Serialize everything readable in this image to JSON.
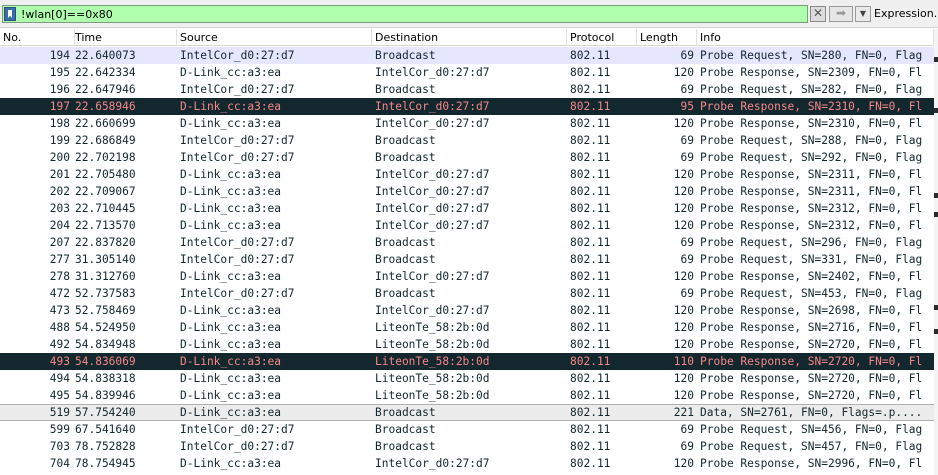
{
  "filter": {
    "value": "!wlan[0]==0x80",
    "clear_glyph": "✕",
    "apply_glyph": "➡",
    "dropdown_glyph": "▼",
    "expression_label": "Expression..."
  },
  "columns": [
    "No.",
    "Time",
    "Source",
    "Destination",
    "Protocol",
    "Length",
    "Info"
  ],
  "colors": {
    "filter_bg": "#afffaf",
    "row_blue": "#e7e6ff",
    "selected_bg": "#12272e",
    "selected_fg": "#f78787",
    "row_gray": "#ececec"
  },
  "icons": {
    "bookmark": "bookmark-icon",
    "clear": "clear-icon",
    "apply": "arrow-right-icon",
    "dropdown": "chevron-down-icon"
  },
  "packets": [
    {
      "no": "194",
      "time": "22.640073",
      "src": "IntelCor_d0:27:d7",
      "dst": "Broadcast",
      "proto": "802.11",
      "len": "69",
      "info": "Probe Request, SN=280, FN=0, Flag",
      "style": "blue"
    },
    {
      "no": "195",
      "time": "22.642334",
      "src": "D-Link_cc:a3:ea",
      "dst": "IntelCor_d0:27:d7",
      "proto": "802.11",
      "len": "120",
      "info": "Probe Response, SN=2309, FN=0, Fl",
      "style": "normal"
    },
    {
      "no": "196",
      "time": "22.647946",
      "src": "IntelCor_d0:27:d7",
      "dst": "Broadcast",
      "proto": "802.11",
      "len": "69",
      "info": "Probe Request, SN=282, FN=0, Flag",
      "style": "normal"
    },
    {
      "no": "197",
      "time": "22.658946",
      "src": "D-Link_cc:a3:ea",
      "dst": "IntelCor_d0:27:d7",
      "proto": "802.11",
      "len": "95",
      "info": "Probe Response, SN=2310, FN=0, Fl",
      "style": "selected"
    },
    {
      "no": "198",
      "time": "22.660699",
      "src": "D-Link_cc:a3:ea",
      "dst": "IntelCor_d0:27:d7",
      "proto": "802.11",
      "len": "120",
      "info": "Probe Response, SN=2310, FN=0, Fl",
      "style": "normal"
    },
    {
      "no": "199",
      "time": "22.686849",
      "src": "IntelCor_d0:27:d7",
      "dst": "Broadcast",
      "proto": "802.11",
      "len": "69",
      "info": "Probe Request, SN=288, FN=0, Flag",
      "style": "normal"
    },
    {
      "no": "200",
      "time": "22.702198",
      "src": "IntelCor_d0:27:d7",
      "dst": "Broadcast",
      "proto": "802.11",
      "len": "69",
      "info": "Probe Request, SN=292, FN=0, Flag",
      "style": "normal"
    },
    {
      "no": "201",
      "time": "22.705480",
      "src": "D-Link_cc:a3:ea",
      "dst": "IntelCor_d0:27:d7",
      "proto": "802.11",
      "len": "120",
      "info": "Probe Response, SN=2311, FN=0, Fl",
      "style": "normal"
    },
    {
      "no": "202",
      "time": "22.709067",
      "src": "D-Link_cc:a3:ea",
      "dst": "IntelCor_d0:27:d7",
      "proto": "802.11",
      "len": "120",
      "info": "Probe Response, SN=2311, FN=0, Fl",
      "style": "normal"
    },
    {
      "no": "203",
      "time": "22.710445",
      "src": "D-Link_cc:a3:ea",
      "dst": "IntelCor_d0:27:d7",
      "proto": "802.11",
      "len": "120",
      "info": "Probe Response, SN=2312, FN=0, Fl",
      "style": "normal"
    },
    {
      "no": "204",
      "time": "22.713570",
      "src": "D-Link_cc:a3:ea",
      "dst": "IntelCor_d0:27:d7",
      "proto": "802.11",
      "len": "120",
      "info": "Probe Response, SN=2312, FN=0, Fl",
      "style": "normal"
    },
    {
      "no": "207",
      "time": "22.837820",
      "src": "IntelCor_d0:27:d7",
      "dst": "Broadcast",
      "proto": "802.11",
      "len": "69",
      "info": "Probe Request, SN=296, FN=0, Flag",
      "style": "normal"
    },
    {
      "no": "277",
      "time": "31.305140",
      "src": "IntelCor_d0:27:d7",
      "dst": "Broadcast",
      "proto": "802.11",
      "len": "69",
      "info": "Probe Request, SN=331, FN=0, Flag",
      "style": "normal"
    },
    {
      "no": "278",
      "time": "31.312760",
      "src": "D-Link_cc:a3:ea",
      "dst": "IntelCor_d0:27:d7",
      "proto": "802.11",
      "len": "120",
      "info": "Probe Response, SN=2402, FN=0, Fl",
      "style": "normal"
    },
    {
      "no": "472",
      "time": "52.737583",
      "src": "IntelCor_d0:27:d7",
      "dst": "Broadcast",
      "proto": "802.11",
      "len": "69",
      "info": "Probe Request, SN=453, FN=0, Flag",
      "style": "normal"
    },
    {
      "no": "473",
      "time": "52.758469",
      "src": "D-Link_cc:a3:ea",
      "dst": "IntelCor_d0:27:d7",
      "proto": "802.11",
      "len": "120",
      "info": "Probe Response, SN=2698, FN=0, Fl",
      "style": "normal"
    },
    {
      "no": "488",
      "time": "54.524950",
      "src": "D-Link_cc:a3:ea",
      "dst": "LiteonTe_58:2b:0d",
      "proto": "802.11",
      "len": "120",
      "info": "Probe Response, SN=2716, FN=0, Fl",
      "style": "normal"
    },
    {
      "no": "492",
      "time": "54.834948",
      "src": "D-Link_cc:a3:ea",
      "dst": "LiteonTe_58:2b:0d",
      "proto": "802.11",
      "len": "120",
      "info": "Probe Response, SN=2720, FN=0, Fl",
      "style": "normal"
    },
    {
      "no": "493",
      "time": "54.836069",
      "src": "D-Link_cc:a3:ea",
      "dst": "LiteonTe_58:2b:0d",
      "proto": "802.11",
      "len": "110",
      "info": "Probe Response, SN=2720, FN=0, Fl",
      "style": "selected"
    },
    {
      "no": "494",
      "time": "54.838318",
      "src": "D-Link_cc:a3:ea",
      "dst": "LiteonTe_58:2b:0d",
      "proto": "802.11",
      "len": "120",
      "info": "Probe Response, SN=2720, FN=0, Fl",
      "style": "normal"
    },
    {
      "no": "495",
      "time": "54.839946",
      "src": "D-Link_cc:a3:ea",
      "dst": "LiteonTe_58:2b:0d",
      "proto": "802.11",
      "len": "120",
      "info": "Probe Response, SN=2720, FN=0, Fl",
      "style": "normal"
    },
    {
      "no": "519",
      "time": "57.754240",
      "src": "D-Link_cc:a3:ea",
      "dst": "Broadcast",
      "proto": "802.11",
      "len": "221",
      "info": "Data, SN=2761, FN=0, Flags=.p....",
      "style": "gray"
    },
    {
      "no": "599",
      "time": "67.541640",
      "src": "IntelCor_d0:27:d7",
      "dst": "Broadcast",
      "proto": "802.11",
      "len": "69",
      "info": "Probe Request, SN=456, FN=0, Flag",
      "style": "normal"
    },
    {
      "no": "703",
      "time": "78.752828",
      "src": "IntelCor_d0:27:d7",
      "dst": "Broadcast",
      "proto": "802.11",
      "len": "69",
      "info": "Probe Request, SN=457, FN=0, Flag",
      "style": "normal"
    },
    {
      "no": "704",
      "time": "78.754945",
      "src": "D-Link_cc:a3:ea",
      "dst": "IntelCor_d0:27:d7",
      "proto": "802.11",
      "len": "120",
      "info": "Probe Response, SN=2996, FN=0, Fl",
      "style": "normal"
    }
  ]
}
